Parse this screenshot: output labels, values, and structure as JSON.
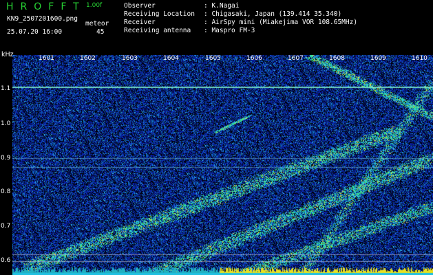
{
  "header": {
    "brand": "HROFFT",
    "version": "1.00f",
    "filename": "KN9_2507201600.png",
    "meteor_label": "meteor",
    "datetime": "25.07.20 16:00",
    "meteor_count": "45",
    "fields": [
      {
        "label": "Observer",
        "value": ": K.Nagai"
      },
      {
        "label": "Receiving Location",
        "value": ": Chigasaki, Japan (139.414 35.340)"
      },
      {
        "label": "Receiver",
        "value": ": AirSpy mini (Miakejima VOR 108.65MHz)"
      },
      {
        "label": "Receiving antenna",
        "value": ": Maspro FM-3"
      }
    ]
  },
  "axes": {
    "y_unit": "kHz",
    "y_ticks": [
      "1.1",
      "1.0",
      "0.9",
      "0.8",
      "0.7",
      "0.6"
    ],
    "x_ticks": [
      "1601",
      "1602",
      "1603",
      "1604",
      "1605",
      "1606",
      "1607",
      "1608",
      "1609",
      "1610"
    ]
  },
  "colors": {
    "background": "#000000",
    "noise": "#0a1a8a",
    "brand": "#27d334",
    "strip": "#e8e020"
  }
}
